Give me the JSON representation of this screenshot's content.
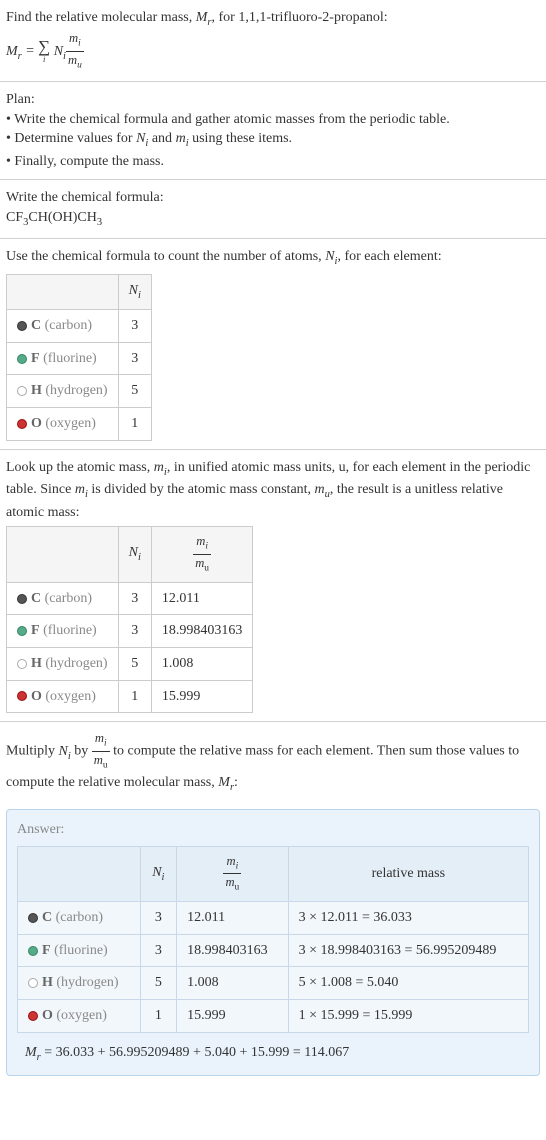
{
  "intro": {
    "line1": "Find the relative molecular mass, ",
    "mr": "M",
    "mr_sub": "r",
    "line1b": ", for 1,1,1-trifluoro-2-propanol:",
    "eq_lhs_M": "M",
    "eq_lhs_r": "r",
    "eq_eq": " = ",
    "sigma_sub": "i",
    "Ni_N": "N",
    "Ni_i": "i",
    "frac_num_m": "m",
    "frac_num_i": "i",
    "frac_den_m": "m",
    "frac_den_u": "u"
  },
  "plan": {
    "heading": "Plan:",
    "b1": "• Write the chemical formula and gather atomic masses from the periodic table.",
    "b2_a": "• Determine values for ",
    "b2_N": "N",
    "b2_Ni": "i",
    "b2_b": " and ",
    "b2_m": "m",
    "b2_mi": "i",
    "b2_c": " using these items.",
    "b3": "• Finally, compute the mass."
  },
  "chemFormula": {
    "heading": "Write the chemical formula:",
    "p1": "CF",
    "s1": "3",
    "p2": "CH(OH)CH",
    "s2": "3"
  },
  "countIntro": {
    "a": "Use the chemical formula to count the number of atoms, ",
    "N": "N",
    "Ni": "i",
    "b": ", for each element:"
  },
  "table1": {
    "header_Ni_N": "N",
    "header_Ni_i": "i",
    "rows": [
      {
        "dot": "gray",
        "sym": "C",
        "name": " (carbon)",
        "n": "3"
      },
      {
        "dot": "green",
        "sym": "F",
        "name": " (fluorine)",
        "n": "3"
      },
      {
        "dot": "white",
        "sym": "H",
        "name": " (hydrogen)",
        "n": "5"
      },
      {
        "dot": "red",
        "sym": "O",
        "name": " (oxygen)",
        "n": "1"
      }
    ]
  },
  "lookup": {
    "a": "Look up the atomic mass, ",
    "m": "m",
    "mi": "i",
    "b": ", in unified atomic mass units, u, for each element in the periodic table. Since ",
    "m2": "m",
    "mi2": "i",
    "c": " is divided by the atomic mass constant, ",
    "mu_m": "m",
    "mu_u": "u",
    "d": ", the result is a unitless relative atomic mass:"
  },
  "table2": {
    "header_Ni_N": "N",
    "header_Ni_i": "i",
    "frac_num_m": "m",
    "frac_num_i": "i",
    "frac_den_m": "m",
    "frac_den_u": "u",
    "rows": [
      {
        "dot": "gray",
        "sym": "C",
        "name": " (carbon)",
        "n": "3",
        "mass": "12.011"
      },
      {
        "dot": "green",
        "sym": "F",
        "name": " (fluorine)",
        "n": "3",
        "mass": "18.998403163"
      },
      {
        "dot": "white",
        "sym": "H",
        "name": " (hydrogen)",
        "n": "5",
        "mass": "1.008"
      },
      {
        "dot": "red",
        "sym": "O",
        "name": " (oxygen)",
        "n": "1",
        "mass": "15.999"
      }
    ]
  },
  "multiply": {
    "a": "Multiply ",
    "N": "N",
    "Ni": "i",
    "b": " by ",
    "frac_num_m": "m",
    "frac_num_i": "i",
    "frac_den_m": "m",
    "frac_den_u": "u",
    "c": " to compute the relative mass for each element. Then sum those values to compute the relative molecular mass, ",
    "Mr_M": "M",
    "Mr_r": "r",
    "d": ":"
  },
  "answer": {
    "title": "Answer:",
    "header_Ni_N": "N",
    "header_Ni_i": "i",
    "frac_num_m": "m",
    "frac_num_i": "i",
    "frac_den_m": "m",
    "frac_den_u": "u",
    "header_rel": "relative mass",
    "rows": [
      {
        "dot": "gray",
        "sym": "C",
        "name": " (carbon)",
        "n": "3",
        "mass": "12.011",
        "rel": "3 × 12.011 = 36.033"
      },
      {
        "dot": "green",
        "sym": "F",
        "name": " (fluorine)",
        "n": "3",
        "mass": "18.998403163",
        "rel": "3 × 18.998403163 = 56.995209489"
      },
      {
        "dot": "white",
        "sym": "H",
        "name": " (hydrogen)",
        "n": "5",
        "mass": "1.008",
        "rel": "5 × 1.008 = 5.040"
      },
      {
        "dot": "red",
        "sym": "O",
        "name": " (oxygen)",
        "n": "1",
        "mass": "15.999",
        "rel": "1 × 15.999 = 15.999"
      }
    ],
    "final_M": "M",
    "final_r": "r",
    "final_eq": " = 36.033 + 56.995209489 + 5.040 + 15.999 = 114.067"
  }
}
